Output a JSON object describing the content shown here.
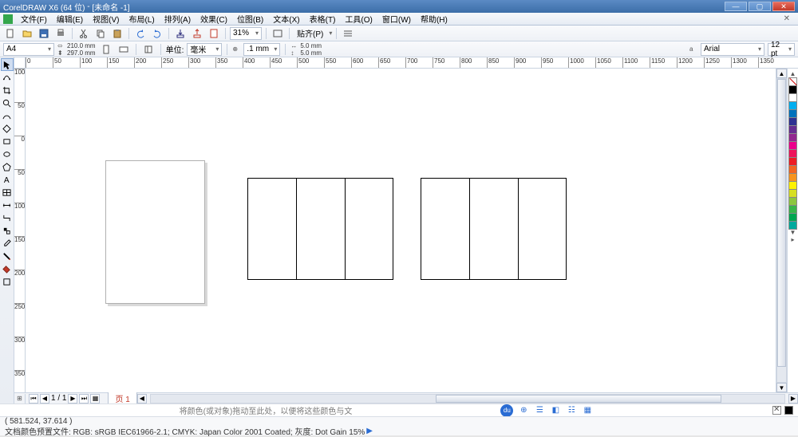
{
  "title": {
    "app": "CorelDRAW X6 (64 位)",
    "doc": "[未命名 -1]"
  },
  "win": {
    "min": "—",
    "max": "▢",
    "close": "✕"
  },
  "menu": {
    "items": [
      "文件(F)",
      "编辑(E)",
      "视图(V)",
      "布局(L)",
      "排列(A)",
      "效果(C)",
      "位图(B)",
      "文本(X)",
      "表格(T)",
      "工具(O)",
      "窗口(W)",
      "帮助(H)"
    ]
  },
  "tba": {
    "zoom": "31%",
    "snap_label": "贴齐(P)"
  },
  "tbb": {
    "page_size": "A4",
    "page_w": "210.0 mm",
    "page_h": "297.0 mm",
    "units_label": "单位:",
    "units_value": "毫米",
    "nudge_small": ".1 mm",
    "nudge_x": "5.0 mm",
    "nudge_y": "5.0 mm",
    "font_name": "Arial",
    "font_size": "12 pt"
  },
  "rulers": {
    "h": [
      "0",
      "50",
      "100",
      "150",
      "200",
      "250",
      "300",
      "350",
      "400",
      "450",
      "500",
      "550",
      "600",
      "650",
      "700",
      "750",
      "800",
      "850",
      "900",
      "950",
      "1000",
      "1050",
      "1100",
      "1150",
      "1200",
      "1250",
      "1300",
      "1350"
    ],
    "v": [
      "100",
      "50",
      "0",
      "50",
      "100",
      "150",
      "200",
      "250",
      "300",
      "350"
    ]
  },
  "palette_colors": [
    "#000000",
    "#ffffff",
    "#00aef0",
    "#0072bc",
    "#2e3192",
    "#662d91",
    "#92278f",
    "#ec008c",
    "#ed145b",
    "#ed1c24",
    "#f26522",
    "#f7941e",
    "#fff200",
    "#d7df23",
    "#8dc63f",
    "#39b54a",
    "#00a651",
    "#00a99d"
  ],
  "hsb": {
    "page_of": "1 / 1",
    "tab": "页 1"
  },
  "hint": {
    "text": "将颜色(或对象)拖动至此处，以便将这些颜色与文",
    "du": "du"
  },
  "status": {
    "coords": "( 581.524, 37.614 )",
    "profile": "文档颜色预置文件: RGB: sRGB IEC61966-2.1; CMYK: Japan Color 2001 Coated; 灰度: Dot Gain 15%"
  }
}
